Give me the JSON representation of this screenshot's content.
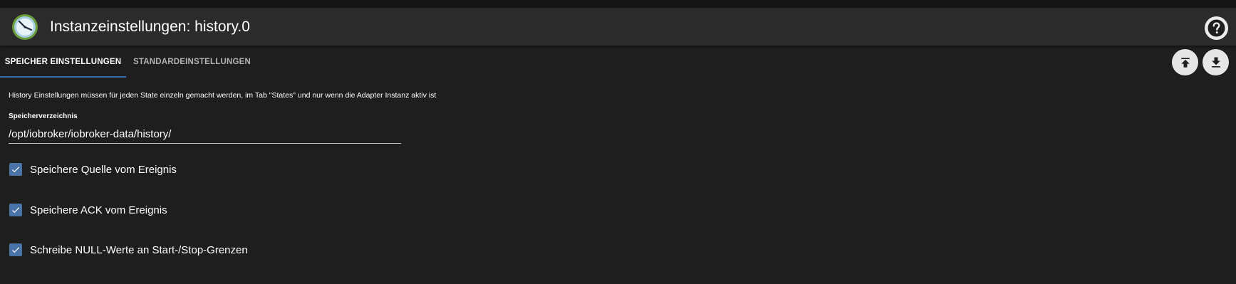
{
  "header": {
    "title": "Instanzeinstellungen: history.0",
    "logo_icon": "history-adapter-logo",
    "help_icon": "help-icon"
  },
  "tabs": [
    {
      "label": "SPEICHER EINSTELLUNGEN",
      "active": true
    },
    {
      "label": "STANDARDEINSTELLUNGEN",
      "active": false
    }
  ],
  "toolbar": {
    "upload_icon": "upload-icon",
    "download_icon": "download-icon"
  },
  "form": {
    "info_text": "History Einstellungen müssen für jeden State einzeln gemacht werden, im Tab \"States\" und nur wenn die Adapter Instanz aktiv ist",
    "storage_dir_label": "Speicherverzeichnis",
    "storage_dir_value": "/opt/iobroker/iobroker-data/history/",
    "checkboxes": [
      {
        "label": "Speichere Quelle vom Ereignis",
        "checked": true
      },
      {
        "label": "Speichere ACK vom Ereignis",
        "checked": true
      },
      {
        "label": "Schreibe NULL-Werte an Start-/Stop-Grenzen",
        "checked": true
      }
    ]
  },
  "colors": {
    "background": "#1e1e1e",
    "header": "#2b2b2b",
    "accent": "#3b6db1",
    "checkbox": "#4a74a8"
  }
}
